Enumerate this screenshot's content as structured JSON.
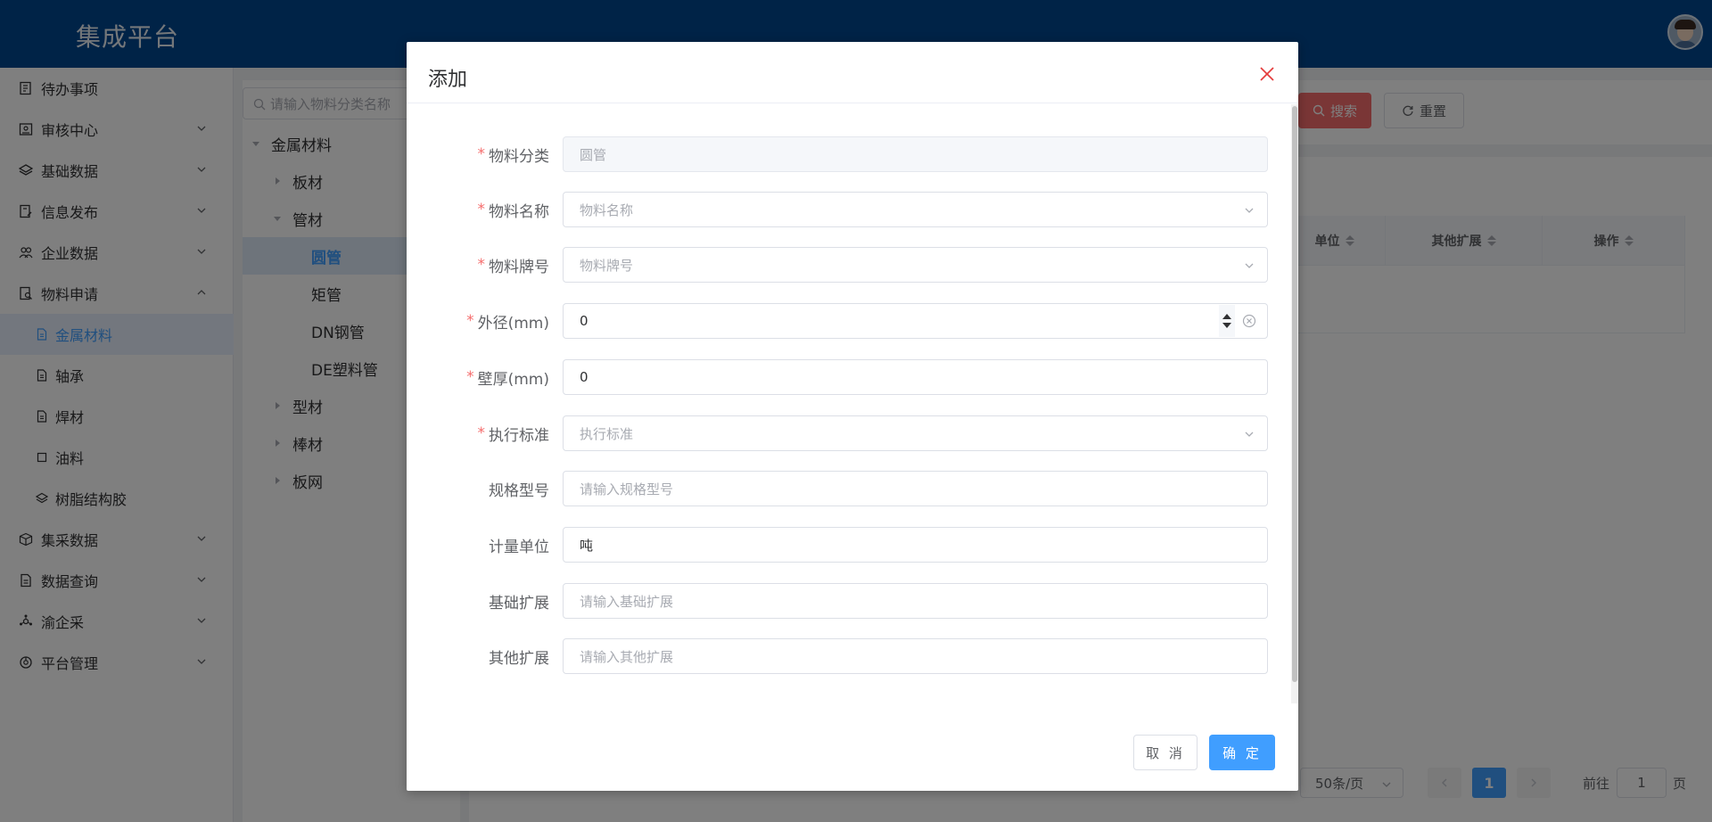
{
  "header": {
    "title": "集成平台"
  },
  "sidebar": {
    "items": [
      {
        "label": "待办事项",
        "icon": "task-list-icon",
        "expandable": false
      },
      {
        "label": "审核中心",
        "icon": "audit-icon",
        "expandable": true
      },
      {
        "label": "基础数据",
        "icon": "layers-icon",
        "expandable": true
      },
      {
        "label": "信息发布",
        "icon": "document-edit-icon",
        "expandable": true
      },
      {
        "label": "企业数据",
        "icon": "users-icon",
        "expandable": true
      },
      {
        "label": "物料申请",
        "icon": "document-search-icon",
        "expandable": true,
        "expanded": true
      },
      {
        "label": "金属材料",
        "icon": "file-icon",
        "sub": true,
        "active": true
      },
      {
        "label": "轴承",
        "icon": "file-icon",
        "sub": true
      },
      {
        "label": "焊材",
        "icon": "file-icon",
        "sub": true
      },
      {
        "label": "油料",
        "icon": "square-icon",
        "sub": true
      },
      {
        "label": "树脂结构胶",
        "icon": "layers-icon",
        "sub": true
      },
      {
        "label": "集采数据",
        "icon": "box-icon",
        "expandable": true
      },
      {
        "label": "数据查询",
        "icon": "file-icon",
        "expandable": true
      },
      {
        "label": "渝企采",
        "icon": "hub-icon",
        "expandable": true
      },
      {
        "label": "平台管理",
        "icon": "settings-icon",
        "expandable": true
      }
    ]
  },
  "tree": {
    "search_placeholder": "请输入物料分类名称",
    "nodes": [
      {
        "label": "金属材料",
        "level": 0,
        "expanded": true
      },
      {
        "label": "板材",
        "level": 1,
        "expanded": false
      },
      {
        "label": "管材",
        "level": 1,
        "expanded": true
      },
      {
        "label": "圆管",
        "level": 2,
        "selected": true
      },
      {
        "label": "矩管",
        "level": 2
      },
      {
        "label": "DN钢管",
        "level": 2
      },
      {
        "label": "DE塑料管",
        "level": 2
      },
      {
        "label": "型材",
        "level": 1,
        "expanded": false
      },
      {
        "label": "棒材",
        "level": 1,
        "expanded": false
      },
      {
        "label": "板网",
        "level": 1,
        "expanded": false
      }
    ]
  },
  "toolbar": {
    "search_label": "搜索",
    "reset_label": "重置"
  },
  "table": {
    "columns": [
      "单位",
      "其他扩展",
      "操作"
    ]
  },
  "pagination": {
    "page_size": "50条/页",
    "current_page": "1",
    "goto_label": "前往",
    "goto_value": "1",
    "page_suffix": "页"
  },
  "dialog": {
    "title": "添加",
    "fields": [
      {
        "label": "物料分类",
        "required": true,
        "value": "圆管",
        "placeholder": "",
        "type": "disabled"
      },
      {
        "label": "物料名称",
        "required": true,
        "value": "",
        "placeholder": "物料名称",
        "type": "select"
      },
      {
        "label": "物料牌号",
        "required": true,
        "value": "",
        "placeholder": "物料牌号",
        "type": "select"
      },
      {
        "label": "外径(mm)",
        "required": true,
        "value": "0",
        "placeholder": "",
        "type": "number"
      },
      {
        "label": "壁厚(mm)",
        "required": true,
        "value": "0",
        "placeholder": "",
        "type": "text"
      },
      {
        "label": "执行标准",
        "required": true,
        "value": "",
        "placeholder": "执行标准",
        "type": "select"
      },
      {
        "label": "规格型号",
        "required": false,
        "value": "",
        "placeholder": "请输入规格型号",
        "type": "text"
      },
      {
        "label": "计量单位",
        "required": false,
        "value": "吨",
        "placeholder": "",
        "type": "text"
      },
      {
        "label": "基础扩展",
        "required": false,
        "value": "",
        "placeholder": "请输入基础扩展",
        "type": "text"
      },
      {
        "label": "其他扩展",
        "required": false,
        "value": "",
        "placeholder": "请输入其他扩展",
        "type": "text"
      }
    ],
    "cancel_label": "取 消",
    "confirm_label": "确 定"
  },
  "colors": {
    "header": "#00478f",
    "primary": "#409eff",
    "danger": "#f56c6c",
    "required": "#f56c6c"
  }
}
